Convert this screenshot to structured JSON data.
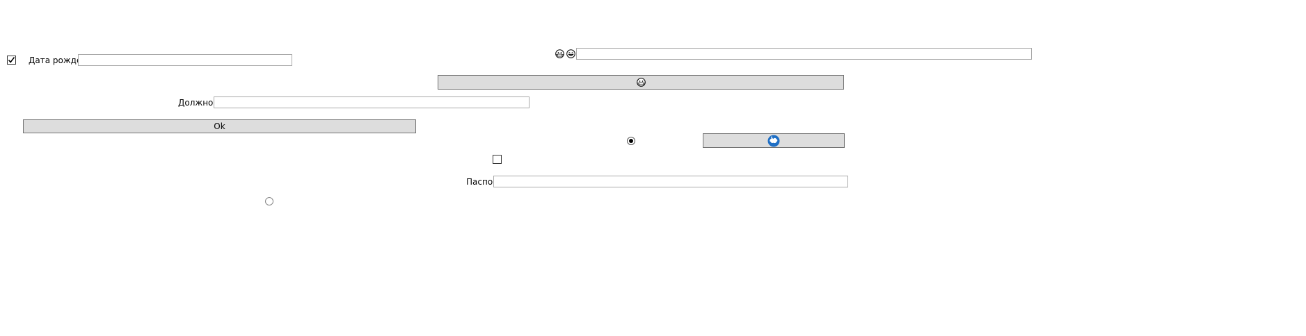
{
  "form": {
    "birth_date": {
      "label": "Дата рождения",
      "value": "",
      "checked": true
    },
    "position": {
      "label": "Должность",
      "value": ""
    },
    "passport": {
      "label": "Паспорт",
      "value": ""
    },
    "ok_button": {
      "label": "Ok"
    },
    "top_field": {
      "value": "",
      "icons": [
        "face-mask-emoji-icon",
        "grinning-face-emoji-icon"
      ]
    },
    "emoji_button": {
      "icon": "face-mask-emoji-icon"
    },
    "globe_button": {
      "icon": "globe-icon",
      "accent": "#1f6fc5"
    },
    "radio_selected": {
      "checked": true
    },
    "radio_unselected": {
      "checked": false
    },
    "lone_checkbox": {
      "checked": false
    }
  }
}
